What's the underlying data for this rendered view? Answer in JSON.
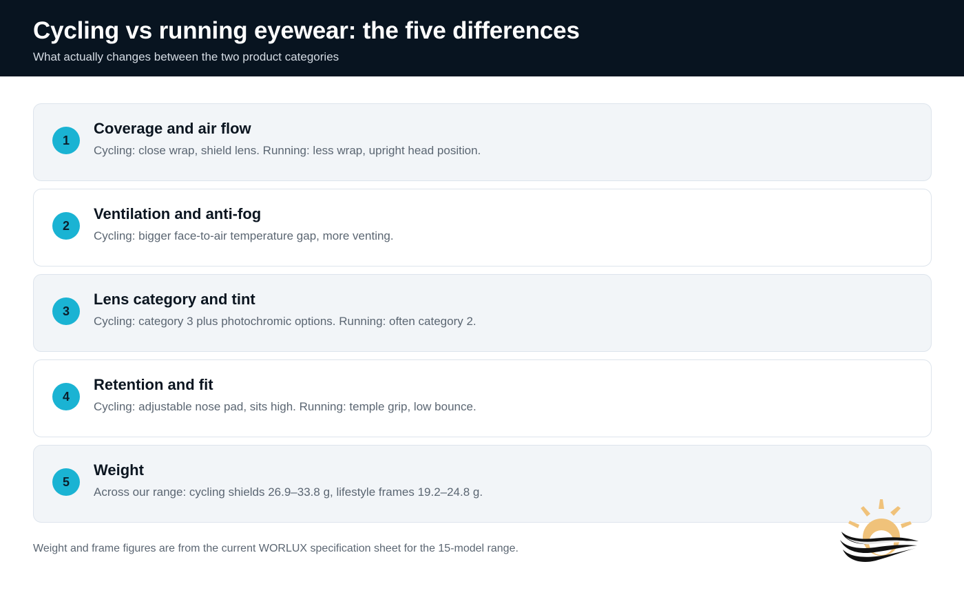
{
  "header": {
    "title": "Cycling vs running eyewear: the five differences",
    "subtitle": "What actually changes between the two product categories"
  },
  "differences": [
    {
      "number": "1",
      "title": "Coverage and air flow",
      "text": "Cycling: close wrap, shield lens. Running: less wrap, upright head position."
    },
    {
      "number": "2",
      "title": "Ventilation and anti-fog",
      "text": "Cycling: bigger face-to-air temperature gap, more venting."
    },
    {
      "number": "3",
      "title": "Lens category and tint",
      "text": "Cycling: category 3 plus photochromic options. Running: often category 2."
    },
    {
      "number": "4",
      "title": "Retention and fit",
      "text": "Cycling: adjustable nose pad, sits high. Running: temple grip, low bounce."
    },
    {
      "number": "5",
      "title": "Weight",
      "text": "Across our range: cycling shields 26.9–33.8 g, lifestyle frames 19.2–24.8 g."
    }
  ],
  "footnote": "Weight and frame figures are from the current WORLUX specification sheet for the 15-model range.",
  "logo": {
    "icon": "sun-wave-logo-icon"
  },
  "colors": {
    "header_bg": "#081420",
    "badge": "#1ab3d3",
    "card_shaded": "#f2f5f8",
    "logo_sun": "#f0c27a",
    "logo_wave": "#111111"
  }
}
